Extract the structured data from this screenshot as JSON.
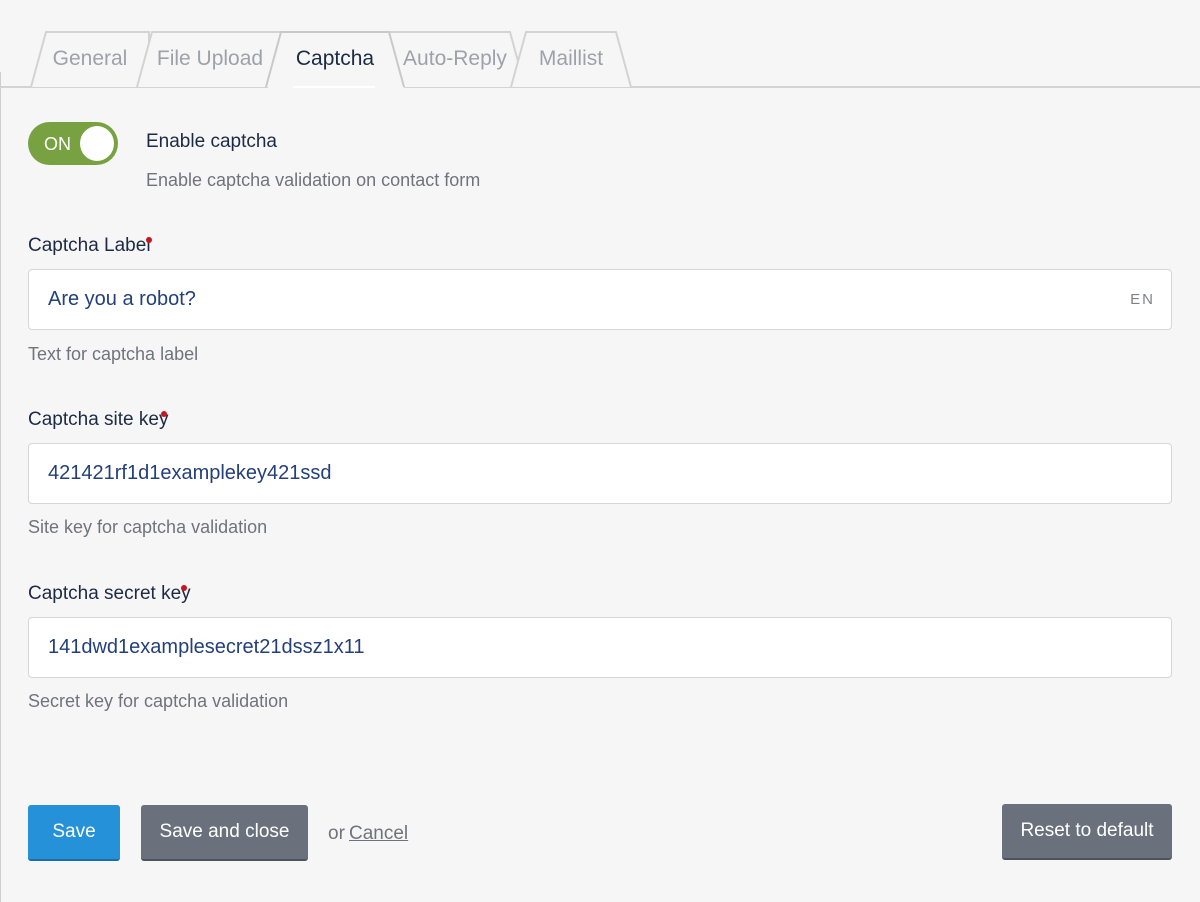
{
  "tabs": [
    {
      "label": "General",
      "active": false
    },
    {
      "label": "File Upload",
      "active": false
    },
    {
      "label": "Captcha",
      "active": true
    },
    {
      "label": "Auto-Reply",
      "active": false
    },
    {
      "label": "Maillist",
      "active": false
    }
  ],
  "toggle": {
    "state_label": "ON",
    "title": "Enable captcha",
    "description": "Enable captcha validation on contact form",
    "color": "#78a242"
  },
  "fields": {
    "label": {
      "label": "Captcha Label",
      "value": "Are you a robot?",
      "lang": "EN",
      "help": "Text for captcha label"
    },
    "site_key": {
      "label": "Captcha site key",
      "value": "421421rf1d1examplekey421ssd",
      "help": "Site key for captcha validation"
    },
    "secret_key": {
      "label": "Captcha secret key",
      "value": "141dwd1examplesecret21dssz1x11",
      "help": "Secret key for captcha validation"
    }
  },
  "actions": {
    "save": "Save",
    "save_close": "Save and close",
    "or": "or",
    "cancel": "Cancel",
    "reset": "Reset to default"
  },
  "colors": {
    "primary": "#2591d8",
    "secondary": "#6a717c",
    "required": "#c9161d"
  }
}
